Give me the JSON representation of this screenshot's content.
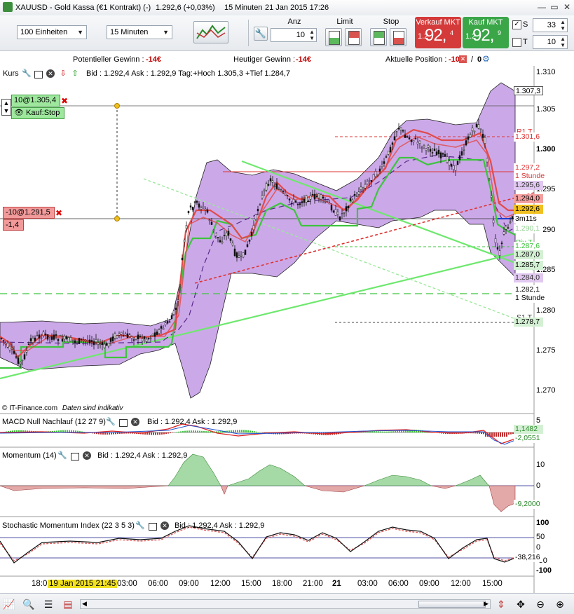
{
  "window": {
    "symbol": "XAUUSD - Gold Kassa (€1 Kontrakt) (-)",
    "change": "1.292,6 (+0,03%)",
    "interval": "15 Minuten",
    "datetime": "21 Jan 2015 17:26"
  },
  "toolbar": {
    "units_combo": "100 Einheiten",
    "interval_combo": "15 Minuten",
    "anz_label": "Anz",
    "anz_value": "10",
    "limit_label": "Limit",
    "stop_label": "Stop",
    "sell_label": "Verkauf MKT",
    "sell_small": "1.2",
    "sell_big": "92,",
    "sell_sup": "4",
    "buy_label": "Kauf MKT",
    "buy_small": "1.2",
    "buy_big": "92,",
    "buy_sup": "9",
    "s_label": "S",
    "s_value": "33",
    "t_label": "T",
    "t_value": "10",
    "colors": {
      "sell": "#d43a3a",
      "buy": "#3aa648"
    }
  },
  "infobar": {
    "pot_label": "Potentieller Gewinn :",
    "pot_value": "-14€",
    "today_label": "Heutiger Gewinn :",
    "today_value": "-14€",
    "pos_label": "Aktuelle Position :",
    "pos_value": "-10",
    "pos_sep": "/",
    "pos_zero": "0"
  },
  "price_pane": {
    "name": "Kurs",
    "quote": "Bid : 1.292,4 Ask : 1.292,9 Tag:+Hoch 1.305,3 +Tief 1.284,7",
    "order_top": "10@1.305,4",
    "order_top_type": "Kauf:Stop",
    "position_label": "-10@1.291,5",
    "position_pnl": "-1,4",
    "watermark": "© IT-Finance.com",
    "watermark_note": "Daten sind indikativ",
    "y_ticks": [
      "1.310",
      "1.305",
      "1.300",
      "1.295",
      "1.290",
      "1.285",
      "1.280",
      "1.275",
      "1.270"
    ],
    "tags": {
      "t1": "1.307,3",
      "t2": "1.301,6",
      "t3": "1.297,2",
      "t3b": "1 Stunde",
      "t4": "1.295,6",
      "t5": "1.294,0",
      "t6": "1.292,6",
      "t7": "3m11s",
      "t8": "1.290,1",
      "t9": "1.287,6",
      "t10": "1.287,0",
      "t11": "1.285,7",
      "t12": "1.284,0",
      "t13": "1.282,1",
      "t13b": "1 Stunde",
      "t14": "1.278,7"
    },
    "r1": "R1 T",
    "piv": "Piv T",
    "s1": "S1 T",
    "colors": {
      "cloud": "#b98ce0",
      "bands": "#e24a4a",
      "green": "#3ec43e"
    }
  },
  "macd_pane": {
    "name": "MACD Null Nachlauf (12 27 9)",
    "quote": "Bid : 1.292,4 Ask : 1.292,9",
    "y_top": "5",
    "v1": "1,1482",
    "v2": "-2,0551"
  },
  "momentum_pane": {
    "name": "Momentum (14)",
    "quote": "Bid : 1.292,4 Ask : 1.292,9",
    "y1": "10",
    "y2": "0",
    "v": "-9,2000"
  },
  "stoch_pane": {
    "name": "Stochastic Momentum Index (22 3 5 3)",
    "quote": "Bid : 1.292,4 Ask : 1.292,9",
    "y1": "100",
    "y2": "50",
    "y3": "0",
    "y4": "-50",
    "y5": "-100",
    "v": "-38,216"
  },
  "xaxis": {
    "labels": [
      "18:0",
      "19 Jan 2015 21:45",
      "03:00",
      "06:00",
      "09:00",
      "12:00",
      "15:00",
      "18:00",
      "21:00",
      "21",
      "03:00",
      "06:00",
      "09:00",
      "12:00",
      "15:00"
    ]
  }
}
